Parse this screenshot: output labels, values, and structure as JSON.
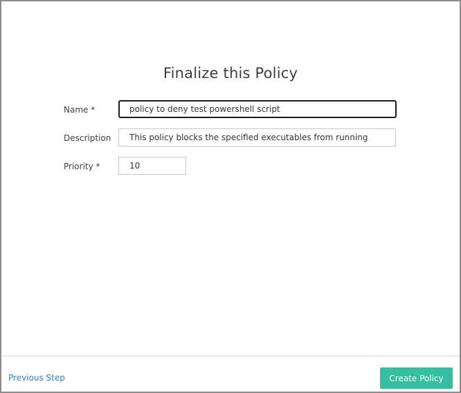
{
  "dialog": {
    "title": "Finalize this Policy"
  },
  "form": {
    "name": {
      "label": "Name *",
      "value": "policy to deny test powershell script"
    },
    "description": {
      "label": "Description",
      "value": "This policy blocks the specified executables from running"
    },
    "priority": {
      "label": "Priority *",
      "value": "10"
    }
  },
  "footer": {
    "previous_label": "Previous Step",
    "submit_label": "Create Policy"
  },
  "colors": {
    "primary_button": "#35bfa0",
    "link": "#2f7fcf"
  }
}
